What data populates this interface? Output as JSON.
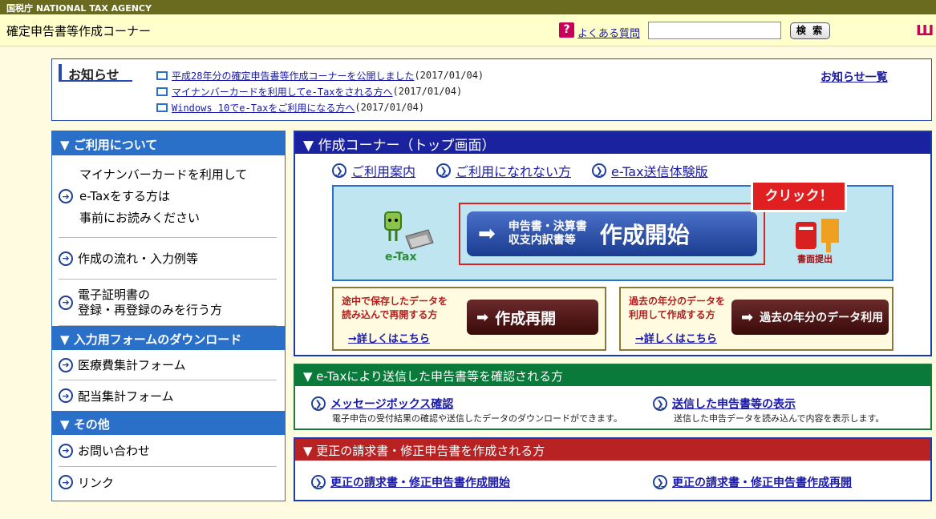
{
  "topbar": {
    "agency": "国税庁 NATIONAL TAX AGENCY"
  },
  "header": {
    "title": "確定申告書等作成コーナー",
    "faq_icon": "?",
    "faq_label": "よくある質問",
    "search_placeholder": "",
    "search_button": "検 索",
    "book_icon": "Ш"
  },
  "news": {
    "label": "お知らせ",
    "all_link": "お知らせ一覧",
    "items": [
      {
        "text": "平成28年分の確定申告書等作成コーナーを公開しました",
        "date": "(2017/01/04)"
      },
      {
        "text": "マイナンバーカードを利用してe-Taxをされる方へ",
        "date": "(2017/01/04)"
      },
      {
        "text": "Windows 10でe-Taxをご利用になる方へ",
        "date": "(2017/01/04)"
      }
    ]
  },
  "sidebar": {
    "section1": "▼ ご利用について",
    "item1_line1": "マイナンバーカードを利用して",
    "item1_line2": "e-Taxをする方は",
    "item1_line3": "事前にお読みください",
    "item2": "作成の流れ・入力例等",
    "item3_line1": "電子証明書の",
    "item3_line2": "登録・再登録のみを行う方",
    "section2": "▼ 入力用フォームのダウンロード",
    "item4": "医療費集計フォーム",
    "item5": "配当集計フォーム",
    "section3": "▼ その他",
    "item6": "お問い合わせ",
    "item7": "リンク"
  },
  "main": {
    "title": "▼ 作成コーナー（トップ画面）",
    "links": [
      "ご利用案内",
      "ご利用になれない方",
      "e-Tax送信体験版"
    ],
    "etax_label": "e-Tax",
    "start_small1": "申告書・決算書",
    "start_small2": "収支内訳書等",
    "start_big": "作成開始",
    "click_badge": "クリック！",
    "paper_label": "書面提出",
    "box1_desc1": "途中で保存したデータを",
    "box1_desc2": "読み込んで再開する方",
    "box1_more": "→詳しくはこちら",
    "box1_button": "作成再開",
    "box2_desc1": "過去の年分のデータを",
    "box2_desc2": "利用して作成する方",
    "box2_more": "→詳しくはこちら",
    "box2_button": "過去の年分のデータ利用"
  },
  "etax_panel": {
    "title": "▼ e-Taxにより送信した申告書等を確認される方",
    "link1": "メッセージボックス確認",
    "sub1": "電子申告の受付結果の確認や送信したデータのダウンロードができます。",
    "link2": "送信した申告書等の表示",
    "sub2": "送信した申告データを読み込んで内容を表示します。"
  },
  "corr_panel": {
    "title": "▼ 更正の請求書・修正申告書を作成される方",
    "link1": "更正の請求書・修正申告書作成開始",
    "link2": "更正の請求書・修正申告書作成再開"
  },
  "colors": {
    "blue": "#1a22a0",
    "green": "#0a7a3a",
    "red": "#b82222",
    "accent_red": "#e02020"
  }
}
